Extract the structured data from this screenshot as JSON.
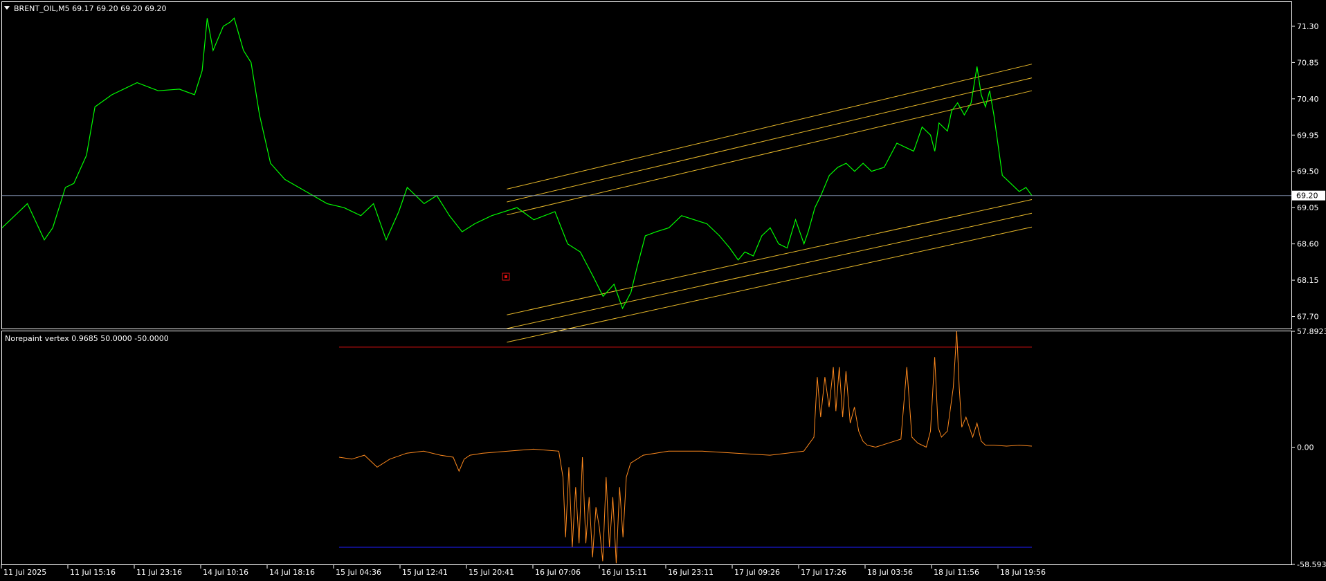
{
  "symbol_header": "BRENT_OIL,M5  69.17 69.20 69.20 69.20",
  "indicator_header": "Norepaint vertex 0.9685 50.0000 -50.0000",
  "current_price": "69.20",
  "price_axis": [
    "71.30",
    "70.85",
    "70.40",
    "69.95",
    "69.50",
    "69.05",
    "68.60",
    "68.15",
    "67.70"
  ],
  "indicator_axis": [
    "57.8923",
    "0.00",
    "-58.5939"
  ],
  "time_axis": [
    "11 Jul 2025",
    "11 Jul 15:16",
    "11 Jul 23:16",
    "14 Jul 10:16",
    "14 Jul 18:16",
    "15 Jul 04:36",
    "15 Jul 12:41",
    "15 Jul 20:41",
    "16 Jul 07:06",
    "16 Jul 15:11",
    "16 Jul 23:11",
    "17 Jul 09:26",
    "17 Jul 17:26",
    "18 Jul 03:56",
    "18 Jul 11:56",
    "18 Jul 19:56"
  ],
  "colors": {
    "background": "#000000",
    "price_line": "#00ff00",
    "channel": "#e8b92a",
    "indicator_line": "#ff8a1e",
    "upper_level": "#e01010",
    "lower_level": "#1a1ae0",
    "frame": "#ffffff",
    "bid_line": "#7a8aa8",
    "marker": "#e01010"
  },
  "chart_data": [
    {
      "type": "line",
      "series": [
        {
          "name": "BRENT_OIL,M5",
          "x": [
            0,
            10,
            30,
            50,
            60,
            75,
            85,
            100,
            110,
            130,
            160,
            185,
            210,
            228,
            237,
            243,
            250,
            262,
            270,
            275,
            286,
            295,
            305,
            318,
            335,
            360,
            385,
            405,
            425,
            440,
            455,
            470,
            480,
            500,
            515,
            530,
            545,
            560,
            580,
            610,
            630,
            655,
            670,
            685,
            700,
            712,
            725,
            735,
            745,
            752,
            762,
            775,
            790,
            805,
            820,
            835,
            850,
            862,
            872,
            880,
            890,
            900,
            910,
            920,
            930,
            940,
            950,
            955,
            963,
            970,
            980,
            990,
            1000,
            1010,
            1020,
            1030,
            1045,
            1060,
            1070,
            1080,
            1090,
            1100,
            1105,
            1110,
            1120,
            1125,
            1132,
            1140,
            1148,
            1155,
            1160,
            1165,
            1170,
            1175,
            1185,
            1195,
            1205,
            1213,
            1220
          ],
          "values": [
            68.8,
            68.9,
            69.1,
            68.65,
            68.8,
            69.3,
            69.35,
            69.7,
            70.3,
            70.45,
            70.6,
            70.5,
            70.52,
            70.45,
            70.75,
            71.4,
            71.0,
            71.3,
            71.35,
            71.4,
            71.0,
            70.85,
            70.2,
            69.6,
            69.4,
            69.25,
            69.1,
            69.05,
            68.95,
            69.1,
            68.65,
            69.0,
            69.3,
            69.1,
            69.2,
            68.95,
            68.75,
            68.85,
            68.95,
            69.05,
            68.9,
            69.0,
            68.6,
            68.5,
            68.2,
            67.95,
            68.1,
            67.8,
            68.0,
            68.3,
            68.7,
            68.75,
            68.8,
            68.95,
            68.9,
            68.85,
            68.7,
            68.55,
            68.4,
            68.5,
            68.45,
            68.7,
            68.8,
            68.6,
            68.55,
            68.9,
            68.6,
            68.75,
            69.05,
            69.2,
            69.45,
            69.55,
            69.6,
            69.5,
            69.6,
            69.5,
            69.55,
            69.85,
            69.8,
            69.75,
            70.05,
            69.95,
            69.75,
            70.1,
            70.0,
            70.25,
            70.35,
            70.2,
            70.35,
            70.8,
            70.45,
            70.3,
            70.5,
            70.2,
            69.45,
            69.35,
            69.25,
            69.3,
            69.2
          ]
        }
      ],
      "channel_lines": [
        {
          "from": [
            598,
            69.28
          ],
          "to": [
            1220,
            70.83
          ]
        },
        {
          "from": [
            598,
            69.12
          ],
          "to": [
            1220,
            70.66
          ]
        },
        {
          "from": [
            598,
            68.96
          ],
          "to": [
            1220,
            70.5
          ]
        },
        {
          "from": [
            598,
            67.72
          ],
          "to": [
            1220,
            69.15
          ]
        },
        {
          "from": [
            598,
            67.55
          ],
          "to": [
            1220,
            68.98
          ]
        },
        {
          "from": [
            598,
            67.38
          ],
          "to": [
            1220,
            68.81
          ]
        }
      ],
      "ylim": [
        67.55,
        71.6
      ]
    },
    {
      "type": "line",
      "series": [
        {
          "name": "Norepaint vertex",
          "x": [
            400,
            415,
            430,
            445,
            460,
            480,
            500,
            520,
            535,
            542,
            548,
            555,
            570,
            600,
            630,
            660,
            665,
            668,
            672,
            676,
            680,
            684,
            688,
            692,
            696,
            700,
            704,
            708,
            712,
            716,
            720,
            724,
            728,
            732,
            736,
            740,
            745,
            760,
            790,
            830,
            870,
            910,
            950,
            962,
            966,
            970,
            975,
            980,
            985,
            988,
            992,
            996,
            1000,
            1005,
            1010,
            1015,
            1020,
            1025,
            1035,
            1050,
            1065,
            1072,
            1078,
            1085,
            1095,
            1100,
            1105,
            1109,
            1113,
            1120,
            1127,
            1131,
            1134,
            1137,
            1142,
            1150,
            1155,
            1160,
            1165,
            1175,
            1190,
            1205,
            1220
          ],
          "values": [
            -5,
            -6,
            -4,
            -10,
            -6,
            -3,
            -2,
            -4,
            -5,
            -12,
            -6,
            -4,
            -3,
            -2,
            -1,
            -2,
            -15,
            -45,
            -10,
            -50,
            -20,
            -48,
            -5,
            -48,
            -25,
            -55,
            -30,
            -40,
            -57,
            -15,
            -50,
            -25,
            -58,
            -20,
            -45,
            -15,
            -8,
            -4,
            -2,
            -2,
            -3,
            -4,
            -2,
            5,
            35,
            15,
            35,
            20,
            40,
            18,
            40,
            15,
            38,
            12,
            20,
            8,
            3,
            1,
            0,
            2,
            4,
            40,
            5,
            2,
            0,
            8,
            45,
            10,
            5,
            8,
            30,
            58,
            30,
            10,
            15,
            5,
            12,
            3,
            1,
            1,
            0.5,
            1,
            0.5
          ]
        }
      ],
      "levels": [
        50,
        -50
      ],
      "ylim": [
        -58.5939,
        57.8923
      ]
    }
  ]
}
